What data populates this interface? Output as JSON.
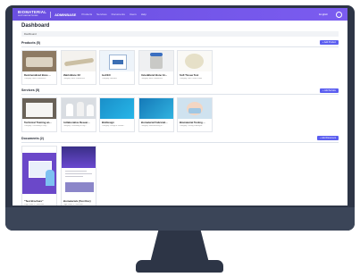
{
  "header": {
    "brand": "BIOMATERIAL",
    "brand_sub": "SUPPLIER NETWORK",
    "portal": "ADMINBASE",
    "nav": [
      "Products",
      "Services",
      "Documents",
      "Users",
      "Help"
    ],
    "language": "English"
  },
  "page": {
    "title": "Dashboard",
    "breadcrumb": "Dashboard"
  },
  "products": {
    "title": "Products (5)",
    "add_label": "+ Add Product",
    "items": [
      {
        "name": "Demineralized Bone ...",
        "category": "Category: Bone Substitutes"
      },
      {
        "name": "MatrixBone X2",
        "category": "Category: Bone Substitutes"
      },
      {
        "name": "IsoCEll",
        "category": "Category: Biocides"
      },
      {
        "name": "OsteoBlend Bone Gr...",
        "category": "Category: Bone Substitutes"
      },
      {
        "name": "Soft Tissue Test",
        "category": "Category: Soft Tissue Grafts"
      }
    ]
  },
  "services": {
    "title": "Services (5)",
    "add_label": "+ Add Service",
    "items": [
      {
        "name": "Technical Training an...",
        "category": "Category: Consulting & Reg..."
      },
      {
        "name": "Collaborative Resear...",
        "category": "Category: Consulting & Reg..."
      },
      {
        "name": "BioDesign",
        "category": "Category: Design & Develo..."
      },
      {
        "name": "Biomaterial Fabricati...",
        "category": "Category: Manufacturing &..."
      },
      {
        "name": "Biomaterial Testing ...",
        "category": "Category: Testing & Analysis"
      }
    ]
  },
  "documents": {
    "title": "Documents (2)",
    "add_label": "+ Add Document",
    "items": [
      {
        "name": "\"Test Brochure\"",
        "category": "Page count: 8 · Brochure"
      },
      {
        "name": "Biomaterials (Test Doc)",
        "category": "Page count: 6 · Brochure"
      }
    ]
  }
}
